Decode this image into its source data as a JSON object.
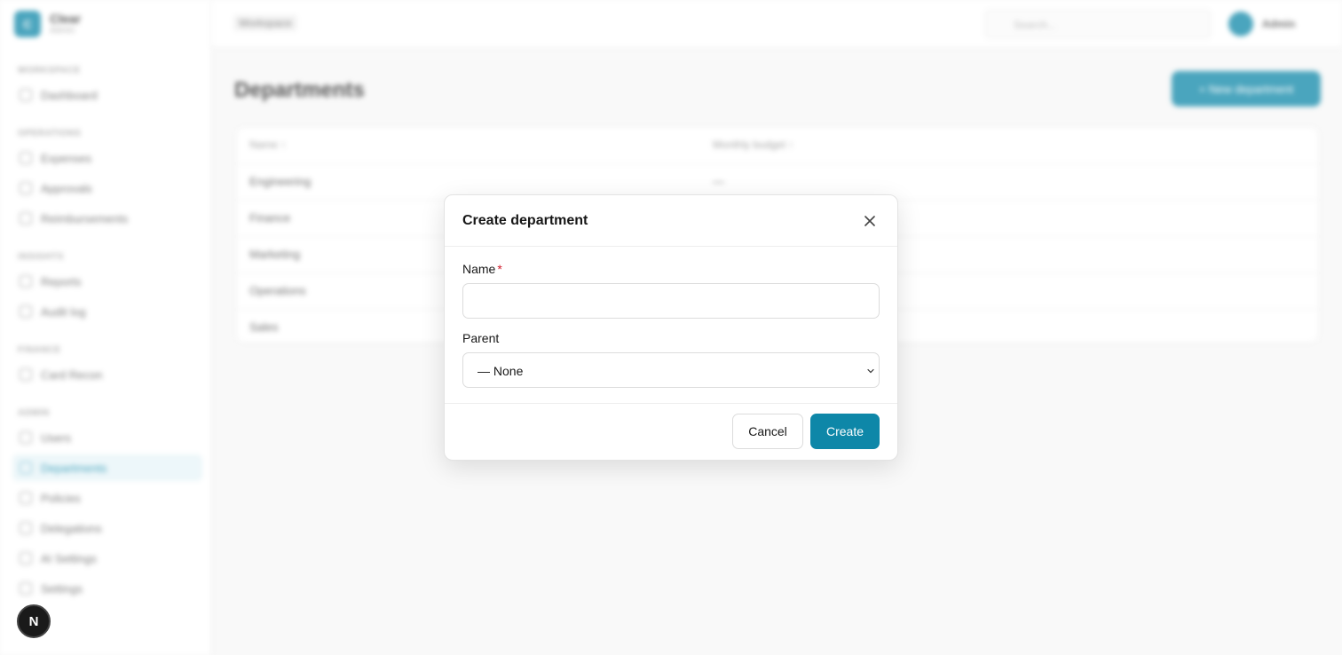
{
  "brand": {
    "logo_letter": "C",
    "name": "Clear",
    "subtitle": "Admin"
  },
  "sidebar": {
    "sections": [
      {
        "label": "WORKSPACE",
        "items": [
          {
            "label": "Dashboard",
            "icon": "grid-icon"
          }
        ]
      },
      {
        "label": "OPERATIONS",
        "items": [
          {
            "label": "Expenses",
            "icon": "receipt-icon"
          },
          {
            "label": "Approvals",
            "icon": "check-circle-icon"
          },
          {
            "label": "Reimbursements",
            "icon": "wallet-icon"
          }
        ]
      },
      {
        "label": "INSIGHTS",
        "items": [
          {
            "label": "Reports",
            "icon": "chart-icon"
          },
          {
            "label": "Audit log",
            "icon": "log-icon"
          }
        ]
      },
      {
        "label": "FINANCE",
        "items": [
          {
            "label": "Card Recon",
            "icon": "card-icon"
          }
        ]
      },
      {
        "label": "ADMIN",
        "items": [
          {
            "label": "Users",
            "icon": "users-icon"
          },
          {
            "label": "Departments",
            "icon": "building-icon",
            "active": true
          },
          {
            "label": "Policies",
            "icon": "policy-icon"
          },
          {
            "label": "Delegations",
            "icon": "delegate-icon"
          },
          {
            "label": "AI Settings",
            "icon": "ai-icon"
          },
          {
            "label": "Settings",
            "icon": "gear-icon"
          }
        ]
      }
    ]
  },
  "topbar": {
    "breadcrumb": "Workspace",
    "search_placeholder": "Search...",
    "user": "Admin"
  },
  "main": {
    "title": "Departments",
    "new_button": "+ New department",
    "table": {
      "columns": [
        "Name ↑",
        "Monthly budget ↑"
      ],
      "rows": [
        [
          "Engineering",
          "—"
        ],
        [
          "Finance",
          ""
        ],
        [
          "Marketing",
          ""
        ],
        [
          "Operations",
          ""
        ],
        [
          "Sales",
          ""
        ]
      ]
    }
  },
  "dialog": {
    "title": "Create department",
    "name_label": "Name",
    "required_mark": "*",
    "name_value": "",
    "parent_label": "Parent",
    "parent_value": "— None",
    "cancel_label": "Cancel",
    "create_label": "Create"
  },
  "fab": {
    "letter": "N"
  },
  "colors": {
    "accent": "#0e87a8",
    "required": "#d11a2a"
  }
}
